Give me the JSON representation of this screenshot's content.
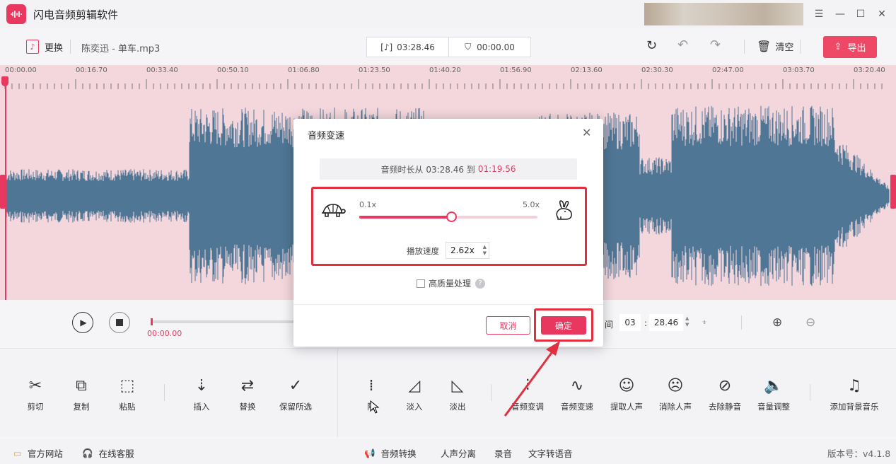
{
  "app": {
    "title": "闪电音频剪辑软件",
    "version_label": "版本号：v4.1.8"
  },
  "colors": {
    "accent": "#e8385f",
    "wave": "#4f7695",
    "wave_bg": "#f3d7dc"
  },
  "toolbar": {
    "replace_label": "更换",
    "file_name": "陈奕迅 - 单车.mp3",
    "duration": "03:28.46",
    "cursor_time": "00:00.00",
    "clear_label": "清空",
    "export_label": "导出"
  },
  "ruler": {
    "labels": [
      "00:00.00",
      "00:16.70",
      "00:33.40",
      "00:50.10",
      "01:06.80",
      "01:23.50",
      "01:40.20",
      "01:56.90",
      "02:13.60",
      "02:30.30",
      "02:47.00",
      "03:03.70",
      "03:20.40"
    ]
  },
  "player": {
    "current_time": "00:00.00",
    "end_label": "间",
    "end_min": "03",
    "end_sec": "28.46"
  },
  "tools": [
    {
      "label": "剪切",
      "icon": "scissors-icon",
      "glyph": "✂"
    },
    {
      "label": "复制",
      "icon": "copy-icon",
      "glyph": "⧉"
    },
    {
      "label": "粘贴",
      "icon": "paste-icon",
      "glyph": "⬚"
    },
    {
      "label": "插入",
      "icon": "insert-icon",
      "glyph": "⇣"
    },
    {
      "label": "替换",
      "icon": "replace-icon",
      "glyph": "⇄"
    },
    {
      "label": "保留所选",
      "icon": "keep-selection-icon",
      "glyph": "✓"
    },
    {
      "label": "降",
      "icon": "noise-icon",
      "glyph": "⁞"
    },
    {
      "label": "淡入",
      "icon": "fade-in-icon",
      "glyph": "◿"
    },
    {
      "label": "淡出",
      "icon": "fade-out-icon",
      "glyph": "◺"
    },
    {
      "label": "音频变调",
      "icon": "pitch-icon",
      "glyph": "⫶"
    },
    {
      "label": "音频变速",
      "icon": "speed-icon",
      "glyph": "∿"
    },
    {
      "label": "提取人声",
      "icon": "extract-voice-icon",
      "glyph": "☺"
    },
    {
      "label": "消除人声",
      "icon": "remove-voice-icon",
      "glyph": "☹"
    },
    {
      "label": "去除静音",
      "icon": "remove-silence-icon",
      "glyph": "⊘"
    },
    {
      "label": "音量调整",
      "icon": "volume-icon",
      "glyph": "🔈"
    },
    {
      "label": "添加背景音乐",
      "icon": "music-note-icon",
      "glyph": "♫"
    }
  ],
  "footer": {
    "website": "官方网站",
    "support": "在线客服",
    "convert": "音频转换",
    "separate": "人声分离",
    "record": "录音",
    "tts": "文字转语音"
  },
  "dialog": {
    "title": "音频变速",
    "duration_prefix": "音频时长从 03:28.46 到",
    "duration_new": "01:19.56",
    "min_speed": "0.1x",
    "max_speed": "5.0x",
    "speed_fraction": 0.5146,
    "speed_label": "播放速度",
    "speed_value": "2.62x",
    "hq_label": "高质量处理",
    "cancel_label": "取消",
    "ok_label": "确定"
  }
}
